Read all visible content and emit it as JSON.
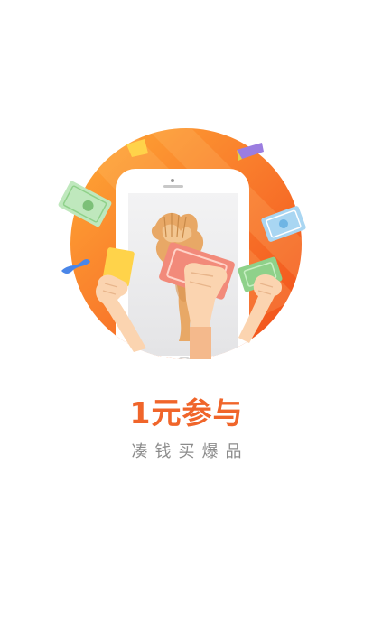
{
  "splash": {
    "headline": "1元参与",
    "tagline": "凑钱买爆品"
  },
  "colors": {
    "accent": "#f0652a",
    "circle_light": "#ff9a2e",
    "circle_dark": "#f4561e",
    "tagline_text": "#8c8c8c",
    "background": "#ffffff"
  },
  "icons": {
    "illustration": "phone-with-raised-fists-and-cash-illustration"
  }
}
